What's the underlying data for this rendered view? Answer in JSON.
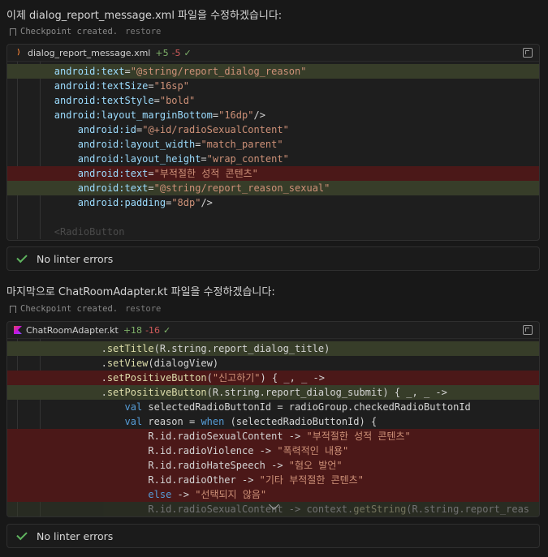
{
  "messages": [
    "이제 dialog_report_message.xml 파일을 수정하겠습니다:",
    "마지막으로 ChatRoomAdapter.kt 파일을 수정하겠습니다:"
  ],
  "checkpoint": {
    "text": "Checkpoint created.",
    "restore": "restore"
  },
  "files": [
    {
      "name": "dialog_report_message.xml",
      "added": "+5",
      "removed": "-5",
      "status": "✓"
    },
    {
      "name": "ChatRoomAdapter.kt",
      "added": "+18",
      "removed": "-16",
      "status": "✓"
    }
  ],
  "linter": "No linter errors",
  "xml_lines": [
    {
      "kind": "add",
      "text": "        android:text=\"@string/report_dialog_reason\""
    },
    {
      "kind": "ctx",
      "text": "        android:textSize=\"16sp\""
    },
    {
      "kind": "ctx",
      "text": "        android:textStyle=\"bold\""
    },
    {
      "kind": "ctx",
      "text": "        android:layout_marginBottom=\"16dp\"/>"
    },
    {
      "kind": "ctx",
      "text": "            android:id=\"@+id/radioSexualContent\""
    },
    {
      "kind": "ctx",
      "text": "            android:layout_width=\"match_parent\""
    },
    {
      "kind": "ctx",
      "text": "            android:layout_height=\"wrap_content\""
    },
    {
      "kind": "del",
      "text": "            android:text=\"부적절한 성적 콘텐츠\""
    },
    {
      "kind": "add",
      "text": "            android:text=\"@string/report_reason_sexual\""
    },
    {
      "kind": "ctx",
      "text": "            android:padding=\"8dp\"/>"
    },
    {
      "kind": "ctx",
      "text": ""
    },
    {
      "kind": "dim",
      "text": "        <RadioButton"
    }
  ],
  "kt_lines": [
    {
      "kind": "add",
      "text": "                .setTitle(R.string.report_dialog_title)"
    },
    {
      "kind": "ctx",
      "text": "                .setView(dialogView)"
    },
    {
      "kind": "del",
      "text": "                .setPositiveButton(\"신고하기\") { _, _ ->"
    },
    {
      "kind": "add",
      "text": "                .setPositiveButton(R.string.report_dialog_submit) { _, _ ->"
    },
    {
      "kind": "ctx",
      "text": "                    val selectedRadioButtonId = radioGroup.checkedRadioButtonId"
    },
    {
      "kind": "ctx",
      "text": "                    val reason = when (selectedRadioButtonId) {"
    },
    {
      "kind": "del",
      "text": "                        R.id.radioSexualContent -> \"부적절한 성적 콘텐츠\""
    },
    {
      "kind": "del",
      "text": "                        R.id.radioViolence -> \"폭력적인 내용\""
    },
    {
      "kind": "del",
      "text": "                        R.id.radioHateSpeech -> \"혐오 발언\""
    },
    {
      "kind": "del",
      "text": "                        R.id.radioOther -> \"기타 부적절한 콘텐츠\""
    },
    {
      "kind": "del",
      "text": "                        else -> \"선택되지 않음\""
    },
    {
      "kind": "adddim",
      "text": "                        R.id.radioSexualContent -> context.getString(R.string.report_reas"
    }
  ]
}
